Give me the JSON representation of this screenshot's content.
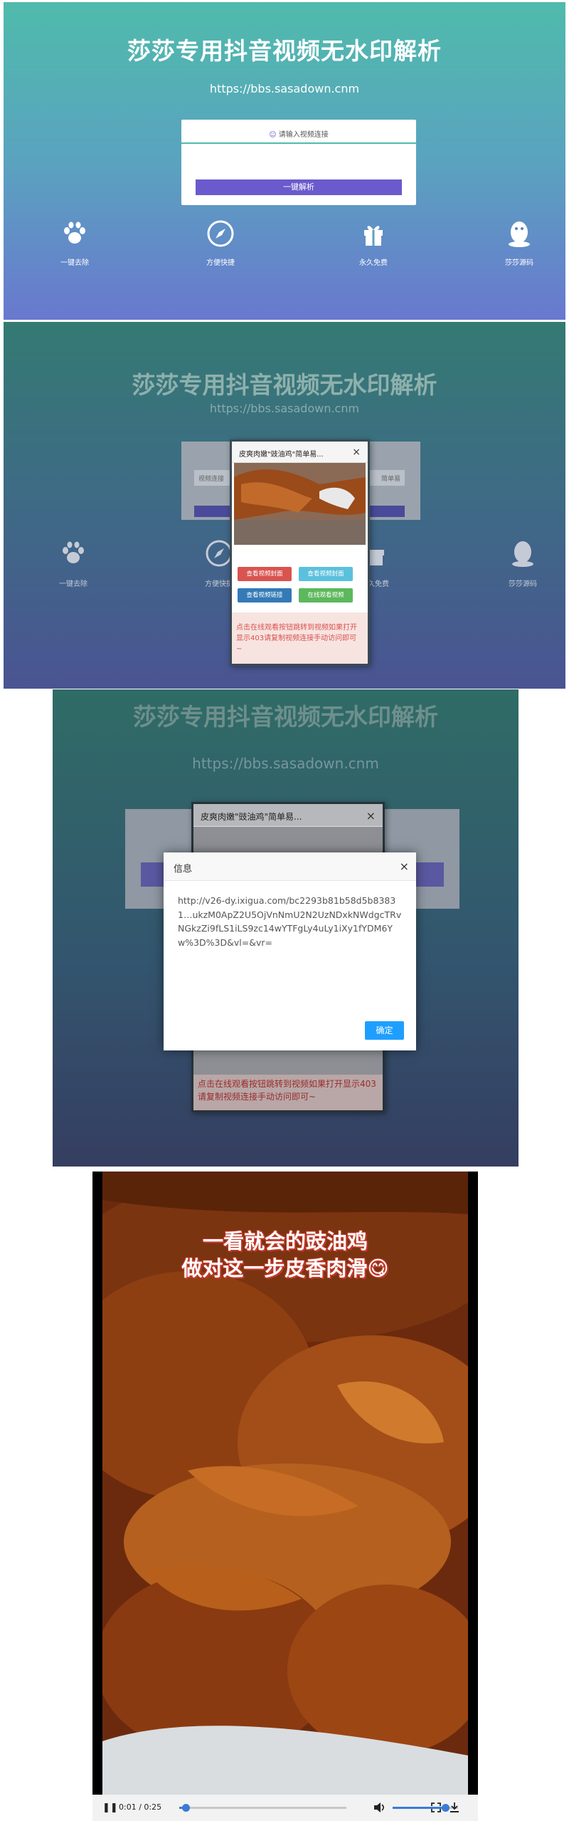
{
  "site": {
    "title": "莎莎专用抖音视频无水印解析",
    "url": "https://bbs.sasadown.cnm"
  },
  "panel1": {
    "input_placeholder": "请输入视频连接",
    "parse_button": "一键解析",
    "features": [
      {
        "icon": "paw-icon",
        "label": "一键去除"
      },
      {
        "icon": "compass-icon",
        "label": "方便快捷"
      },
      {
        "icon": "gift-icon",
        "label": "永久免费"
      },
      {
        "icon": "penguin-icon",
        "label": "莎莎源码"
      }
    ]
  },
  "panel2": {
    "input_left": "视频连接",
    "input_right": "简单易",
    "popup": {
      "title": "皮爽肉嫩\"豉油鸡\"简单易...",
      "close": "×",
      "buttons": [
        {
          "label": "查看视频封面",
          "color": "#d9534f"
        },
        {
          "label": "查看视频封面",
          "color": "#5bc0de"
        },
        {
          "label": "查看视频链接",
          "color": "#337ab7"
        },
        {
          "label": "在线观看视频",
          "color": "#5cb85c"
        }
      ],
      "notice": "点击在线观看按钮跳转到视频如果打开显示403请复制视频连接手动访问即可~"
    }
  },
  "panel3": {
    "popup_title": "皮爽肉嫩\"豉油鸡\"简单易...",
    "popup_close": "×",
    "dialog": {
      "title": "信息",
      "close": "×",
      "body": "http://v26-dy.ixigua.com/bc2293b81b58d5b83831…ukzM0ApZ2U5OjVnNmU2N2UzNDxkNWdgcTRvNGkzZi9fLS1iLS9zc14wYTFgLy4uLy1iXy1fYDM6Yw%3D%3D&vl=&vr=",
      "ok": "确定"
    },
    "notice": "点击在线观看按钮跳转到视频如果打开显示403请复制视频连接手动访问即可~"
  },
  "video": {
    "caption_line1": "一看就会的豉油鸡",
    "caption_line2": "做对这一步皮香肉滑😋",
    "time": "0:01 / 0:25",
    "progress": 0.04,
    "volume": 0.8
  }
}
